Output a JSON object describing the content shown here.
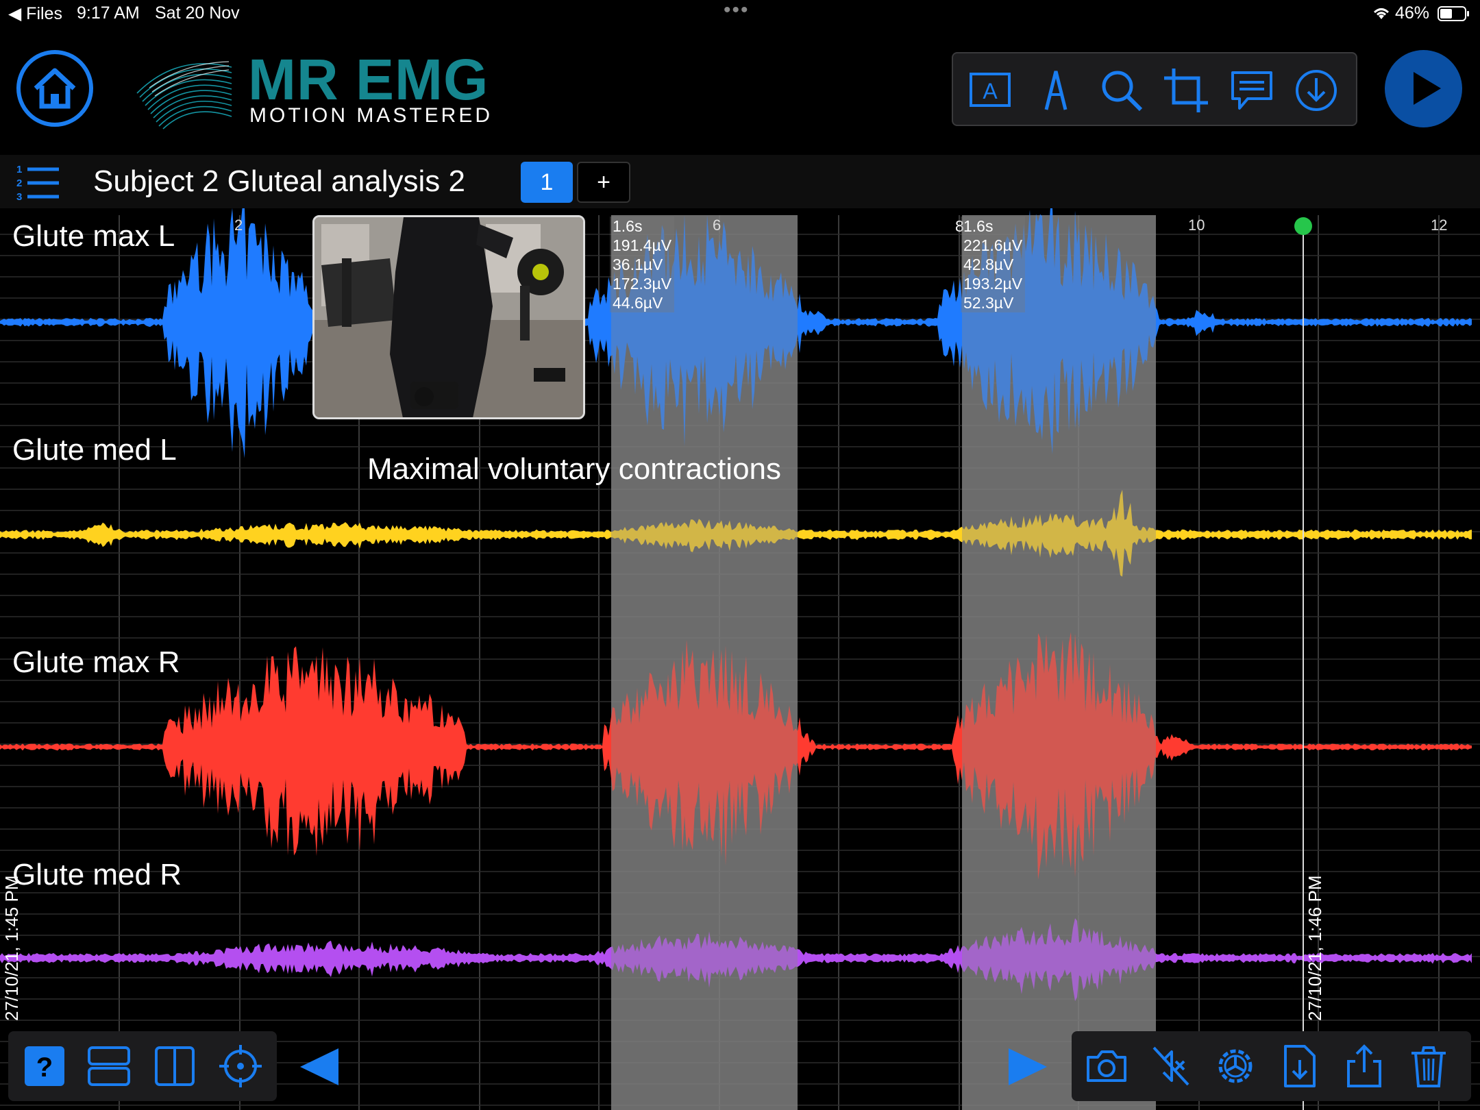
{
  "status_bar": {
    "back_app": "Files",
    "time": "9:17 AM",
    "date": "Sat 20 Nov",
    "battery": "46%"
  },
  "header": {
    "brand_title": "MR EMG",
    "brand_tagline": "MOTION MASTERED",
    "toolbar_icons": [
      "text-label-icon",
      "pen-icon",
      "magnify-icon",
      "crop-icon",
      "comment-icon",
      "download-icon"
    ],
    "accent_color": "#1a7df0"
  },
  "session": {
    "title": "Subject 2 Gluteal analysis  2",
    "active_page": "1",
    "add_page": "+"
  },
  "chart": {
    "time_ticks": [
      "2",
      "6",
      "10",
      "12"
    ],
    "channels": [
      {
        "name": "Glute max L",
        "color": "#1f7bff"
      },
      {
        "name": "Glute med L",
        "color": "#ffd21f"
      },
      {
        "name": "Glute max R",
        "color": "#ff3b30"
      },
      {
        "name": "Glute med R",
        "color": "#b44ff0"
      }
    ],
    "selections": [
      {
        "duration": "1.6s",
        "values": [
          "191.4µV",
          "36.1µV",
          "172.3µV",
          "44.6µV"
        ]
      },
      {
        "duration": "1.6s",
        "marker": "8",
        "values": [
          "221.6µV",
          "42.8µV",
          "193.2µV",
          "52.3µV"
        ]
      }
    ],
    "annotation": "Maximal voluntary contractions",
    "start_stamp": "27/10/21, 1:45 PM",
    "cursor_stamp": "27/10/21, 1:46 PM"
  },
  "bottom_left_icons": [
    "help-icon",
    "stack-layout-icon",
    "split-layout-icon",
    "crosshair-icon"
  ],
  "bottom_right_icons": [
    "camera-icon",
    "mute-icon",
    "settings-icon",
    "file-import-icon",
    "share-icon",
    "trash-icon"
  ]
}
